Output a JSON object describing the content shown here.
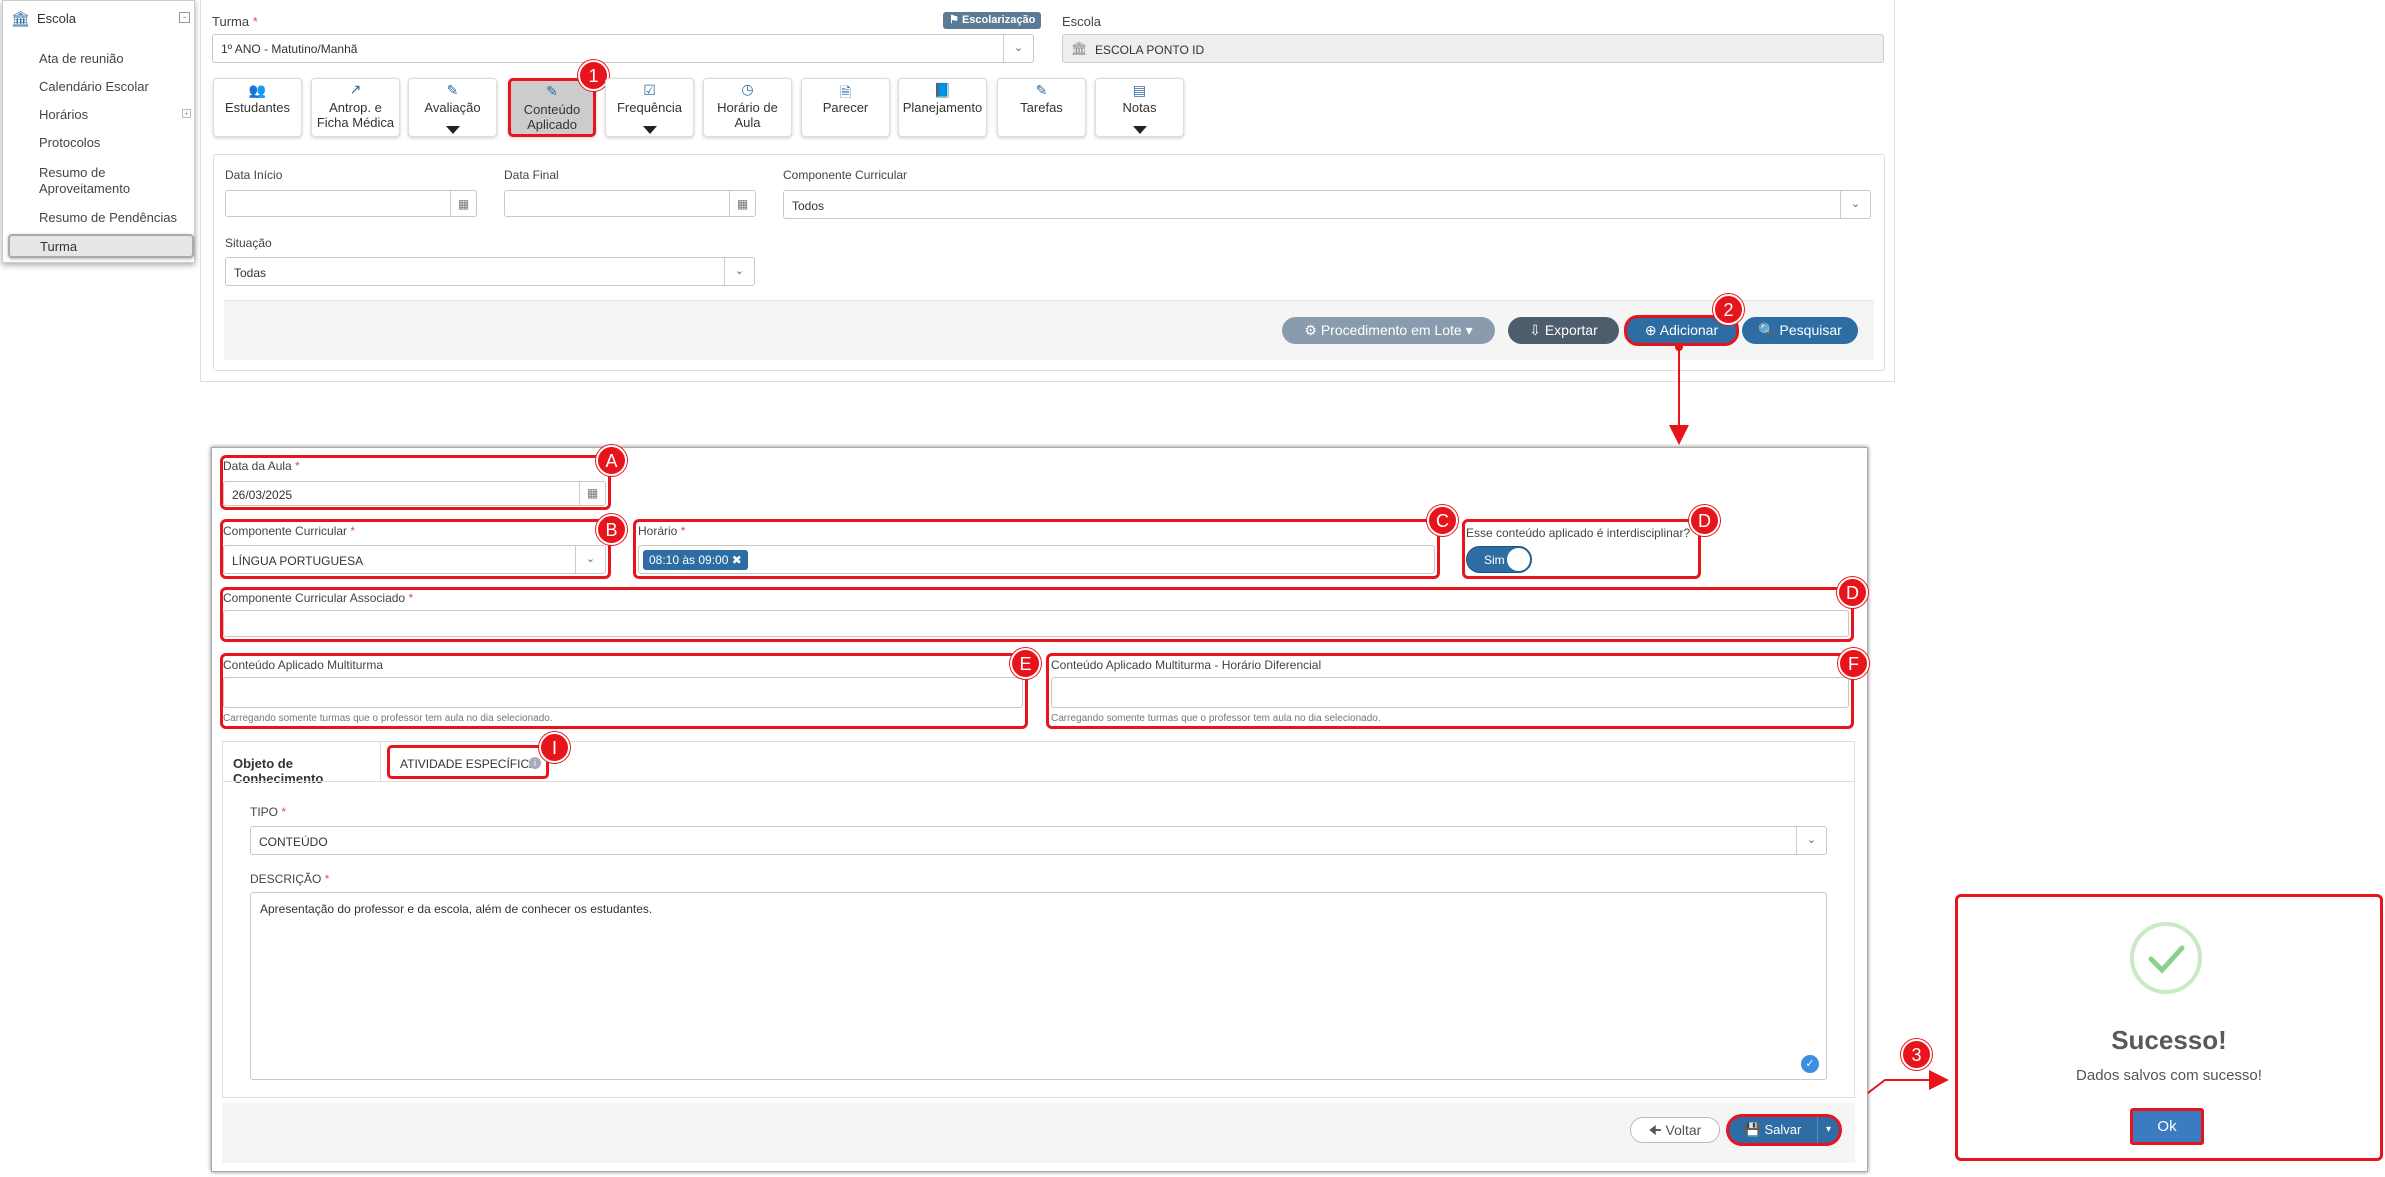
{
  "sidebar": {
    "title": "Escola",
    "items": [
      "Ata de reunião",
      "Calendário Escolar",
      "Horários",
      "Protocolos",
      "Resumo de Aproveitamento",
      "Resumo de Pendências",
      "Turma"
    ]
  },
  "header": {
    "turma_label": "Turma",
    "turma_value": "1º ANO - Matutino/Manhã",
    "escolarizacao": "Escolarização",
    "escola_label": "Escola",
    "escola_value": "ESCOLA PONTO ID"
  },
  "nav": [
    "Estudantes",
    "Antrop. e Ficha Médica",
    "Avaliação",
    "Conteúdo Aplicado",
    "Frequência",
    "Horário de Aula",
    "Parecer",
    "Planejamento",
    "Tarefas",
    "Notas"
  ],
  "filters": {
    "data_inicio": "Data Início",
    "data_final": "Data Final",
    "componente": "Componente Curricular",
    "componente_value": "Todos",
    "situacao": "Situação",
    "situacao_value": "Todas"
  },
  "actions": {
    "lote": "Procedimento em Lote",
    "exportar": "Exportar",
    "adicionar": "Adicionar",
    "pesquisar": "Pesquisar"
  },
  "form": {
    "data_aula_label": "Data da Aula",
    "data_aula_value": "26/03/2025",
    "componente_label": "Componente Curricular",
    "componente_value": "LÍNGUA PORTUGUESA",
    "horario_label": "Horário",
    "horario_tag": "08:10 às 09:00",
    "interdisc_label": "Esse conteúdo aplicado é interdisciplinar?",
    "interdisc_value": "Sim",
    "assoc_label": "Componente Curricular Associado",
    "multi_label": "Conteúdo Aplicado Multiturma",
    "multi_hd_label": "Conteúdo Aplicado Multiturma - Horário Diferencial",
    "hint": "Carregando somente turmas que o professor tem aula no dia selecionado.",
    "tab1": "Objeto de Conhecimento",
    "tab2": "ATIVIDADE ESPECÍFICA",
    "tipo_label": "TIPO",
    "tipo_value": "CONTEÚDO",
    "descricao_label": "DESCRIÇÃO",
    "descricao_value": "Apresentação do professor e da escola, além de conhecer os estudantes.",
    "voltar": "Voltar",
    "salvar": "Salvar"
  },
  "dialog": {
    "title": "Sucesso!",
    "message": "Dados salvos com sucesso!",
    "ok": "Ok"
  },
  "badges": {
    "step1": "1",
    "step2": "2",
    "step3": "3",
    "a": "A",
    "b": "B",
    "c": "C",
    "d1": "D",
    "d2": "D",
    "e": "E",
    "f": "F",
    "i": "I"
  },
  "colors": {
    "primary": "#2e6da4",
    "dark": "#4e5d6c",
    "gray": "#8a9bad",
    "annot": "#e8141c",
    "success": "#8bd08b"
  }
}
